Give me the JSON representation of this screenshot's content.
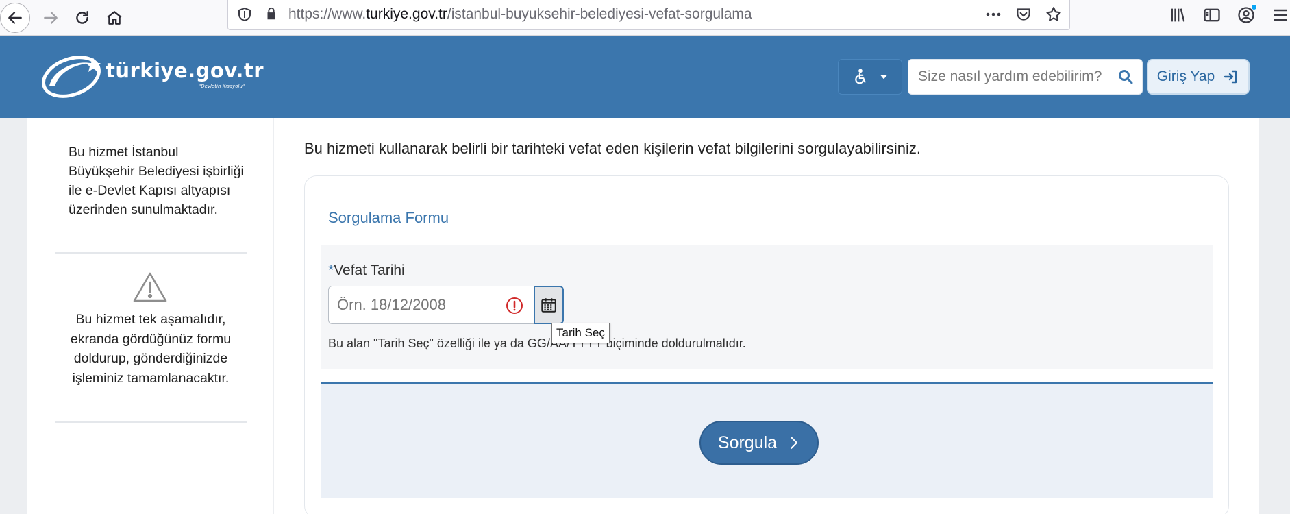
{
  "browser": {
    "url_prefix": "https://www.",
    "url_host": "turkiye.gov.tr",
    "url_path": "/istanbul-buyuksehir-belediyesi-vefat-sorgulama"
  },
  "header": {
    "logo_text": "türkiye.gov.tr",
    "logo_tagline": "\"Devletin Kısayolu\"",
    "search_placeholder": "Size nasıl yardım edebilirim?",
    "login_label": "Giriş Yap",
    "brand_color": "#3b76ad"
  },
  "sidebar": {
    "info_text": "Bu hizmet İstanbul Büyükşehir Belediyesi işbirliği ile e-Devlet Kapısı altyapısı üzerinden sunulmaktadır.",
    "stage_text": "Bu hizmet tek aşamalıdır, ekranda gördüğünüz formu doldurup, gönderdiğinizde işleminiz tamamlanacaktır."
  },
  "main": {
    "intro": "Bu hizmeti kullanarak belirli bir tarihteki vefat eden kişilerin vefat bilgilerini sorgulayabilirsiniz.",
    "form_title": "Sorgulama Formu",
    "field": {
      "required_mark": "*",
      "label": "Vefat Tarihi",
      "placeholder": "Örn. 18/12/2008",
      "value": "",
      "hint": "Bu alan \"Tarih Seç\" özelliği ile ya da GG/AA/YYYY biçiminde doldurulmalıdır.",
      "calendar_tooltip": "Tarih Seç"
    },
    "submit_label": "Sorgula"
  }
}
